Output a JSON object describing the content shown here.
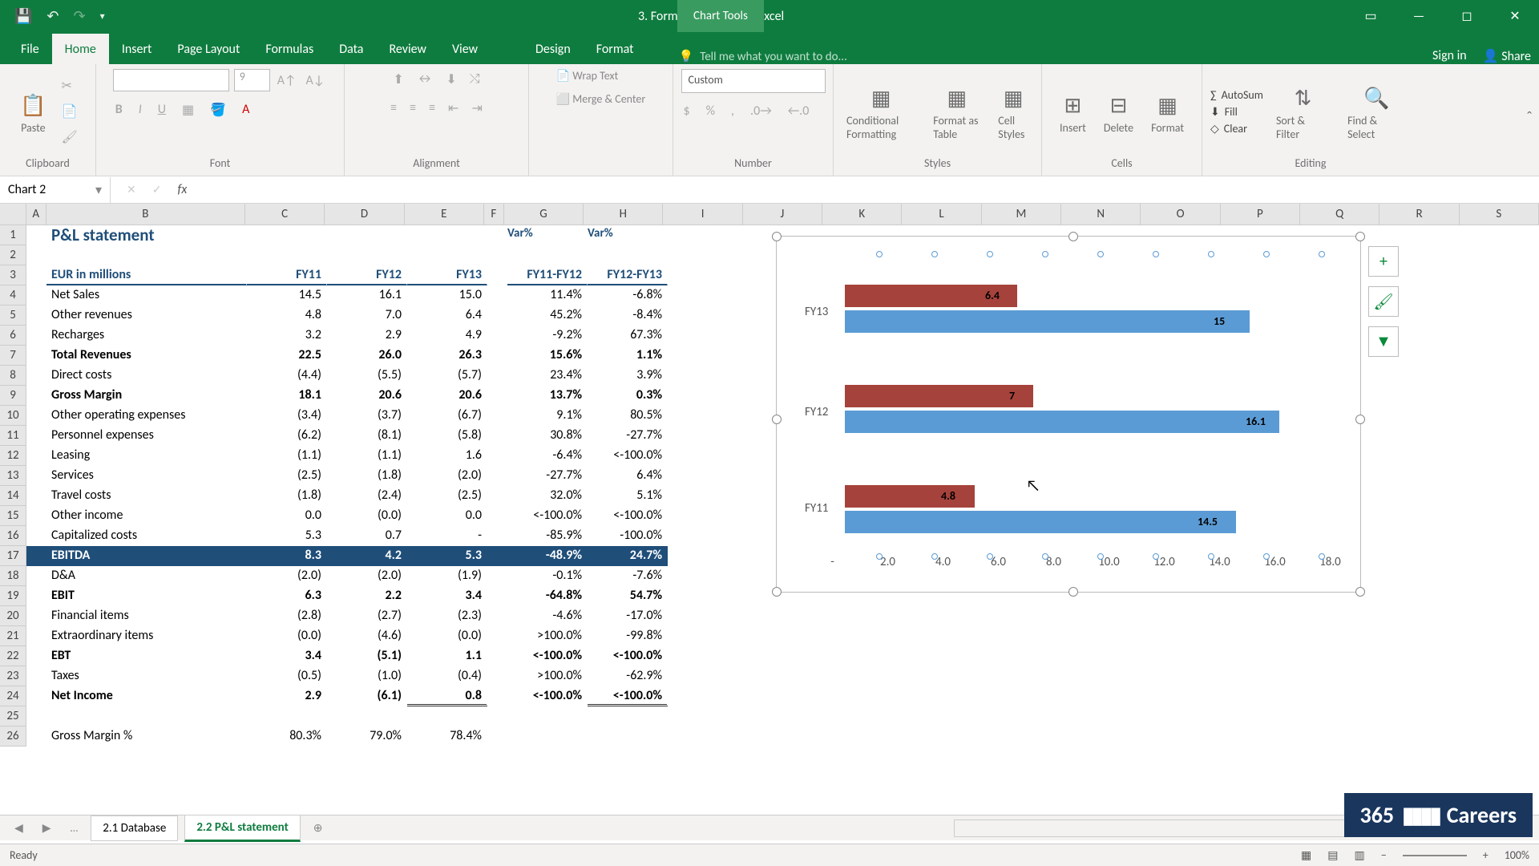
{
  "title": "3. Formatting a Chart - Excel",
  "chartTools": "Chart Tools",
  "tabs": {
    "file": "File",
    "home": "Home",
    "insert": "Insert",
    "pageLayout": "Page Layout",
    "formulas": "Formulas",
    "data": "Data",
    "review": "Review",
    "view": "View",
    "design": "Design",
    "format": "Format"
  },
  "tellme": "Tell me what you want to do...",
  "signin": "Sign in",
  "share": "Share",
  "ribbon": {
    "paste": "Paste",
    "clipboard": "Clipboard",
    "font": "Font",
    "fontsize": "9",
    "alignment": "Alignment",
    "wraptext": "Wrap Text",
    "merge": "Merge & Center",
    "number": "Number",
    "numfmt": "Custom",
    "styles": "Styles",
    "condf": "Conditional Formatting",
    "fmttbl": "Format as Table",
    "cellst": "Cell Styles",
    "cells": "Cells",
    "insert": "Insert",
    "delete": "Delete",
    "format": "Format",
    "editing": "Editing",
    "autosum": "AutoSum",
    "fill": "Fill",
    "clear": "Clear",
    "sortfilter": "Sort & Filter",
    "findsel": "Find & Select"
  },
  "namebox": "Chart 2",
  "sheet": {
    "title": "P&L statement",
    "eurlabel": "EUR in millions",
    "cols": [
      "FY11",
      "FY12",
      "FY13"
    ],
    "varh1": "Var%",
    "varh2": "Var%",
    "varsub1": "FY11-FY12",
    "varsub2": "FY12-FY13",
    "rows": [
      {
        "n": 4,
        "lbl": "Net Sales",
        "v": [
          "14.5",
          "16.1",
          "15.0",
          "11.4%",
          "-6.8%"
        ]
      },
      {
        "n": 5,
        "lbl": "Other revenues",
        "v": [
          "4.8",
          "7.0",
          "6.4",
          "45.2%",
          "-8.4%"
        ]
      },
      {
        "n": 6,
        "lbl": "Recharges",
        "v": [
          "3.2",
          "2.9",
          "4.9",
          "-9.2%",
          "67.3%"
        ]
      },
      {
        "n": 7,
        "lbl": "Total Revenues",
        "b": 1,
        "v": [
          "22.5",
          "26.0",
          "26.3",
          "15.6%",
          "1.1%"
        ]
      },
      {
        "n": 8,
        "lbl": "Direct costs",
        "v": [
          "(4.4)",
          "(5.5)",
          "(5.7)",
          "23.4%",
          "3.9%"
        ]
      },
      {
        "n": 9,
        "lbl": "Gross Margin",
        "b": 1,
        "v": [
          "18.1",
          "20.6",
          "20.6",
          "13.7%",
          "0.3%"
        ]
      },
      {
        "n": 10,
        "lbl": "Other operating expenses",
        "v": [
          "(3.4)",
          "(3.7)",
          "(6.7)",
          "9.1%",
          "80.5%"
        ]
      },
      {
        "n": 11,
        "lbl": "Personnel expenses",
        "v": [
          "(6.2)",
          "(8.1)",
          "(5.8)",
          "30.8%",
          "-27.7%"
        ]
      },
      {
        "n": 12,
        "lbl": "Leasing",
        "v": [
          "(1.1)",
          "(1.1)",
          "1.6",
          "-6.4%",
          "<-100.0%"
        ]
      },
      {
        "n": 13,
        "lbl": "Services",
        "v": [
          "(2.5)",
          "(1.8)",
          "(2.0)",
          "-27.7%",
          "6.4%"
        ]
      },
      {
        "n": 14,
        "lbl": "Travel costs",
        "v": [
          "(1.8)",
          "(2.4)",
          "(2.5)",
          "32.0%",
          "5.1%"
        ]
      },
      {
        "n": 15,
        "lbl": "Other income",
        "v": [
          "0.0",
          "(0.0)",
          "0.0",
          "<-100.0%",
          "<-100.0%"
        ]
      },
      {
        "n": 16,
        "lbl": "Capitalized costs",
        "v": [
          "5.3",
          "0.7",
          "-",
          "-85.9%",
          "-100.0%"
        ]
      },
      {
        "n": 17,
        "lbl": "EBITDA",
        "b": 1,
        "ebitda": 1,
        "v": [
          "8.3",
          "4.2",
          "5.3",
          "-48.9%",
          "24.7%"
        ]
      },
      {
        "n": 18,
        "lbl": "D&A",
        "v": [
          "(2.0)",
          "(2.0)",
          "(1.9)",
          "-0.1%",
          "-7.6%"
        ]
      },
      {
        "n": 19,
        "lbl": "EBIT",
        "b": 1,
        "v": [
          "6.3",
          "2.2",
          "3.4",
          "-64.8%",
          "54.7%"
        ]
      },
      {
        "n": 20,
        "lbl": "Financial items",
        "v": [
          "(2.8)",
          "(2.7)",
          "(2.3)",
          "-4.6%",
          "-17.0%"
        ]
      },
      {
        "n": 21,
        "lbl": "Extraordinary items",
        "v": [
          "(0.0)",
          "(4.6)",
          "(0.0)",
          ">100.0%",
          "-99.8%"
        ]
      },
      {
        "n": 22,
        "lbl": "EBT",
        "b": 1,
        "v": [
          "3.4",
          "(5.1)",
          "1.1",
          "<-100.0%",
          "<-100.0%"
        ]
      },
      {
        "n": 23,
        "lbl": "Taxes",
        "v": [
          "(0.5)",
          "(1.0)",
          "(0.4)",
          ">100.0%",
          "-62.9%"
        ]
      },
      {
        "n": 24,
        "lbl": "Net Income",
        "b": 1,
        "dbl": 1,
        "v": [
          "2.9",
          "(6.1)",
          "0.8",
          "<-100.0%",
          "<-100.0%"
        ]
      }
    ],
    "gm": {
      "lbl": "Gross Margin %",
      "v": [
        "80.3%",
        "79.0%",
        "78.4%"
      ]
    }
  },
  "chart_data": {
    "type": "bar",
    "orientation": "horizontal",
    "categories": [
      "FY13",
      "FY12",
      "FY11"
    ],
    "series": [
      {
        "name": "Net Sales",
        "values": [
          15.0,
          16.1,
          14.5
        ],
        "color": "#5b9bd5"
      },
      {
        "name": "Other revenues",
        "values": [
          6.4,
          7.0,
          4.8
        ],
        "color": "#a5423b"
      }
    ],
    "xlim": [
      0,
      18
    ],
    "xticks": [
      "-",
      "2.0",
      "4.0",
      "6.0",
      "8.0",
      "10.0",
      "12.0",
      "14.0",
      "16.0",
      "18.0"
    ],
    "ylabel": "",
    "xlabel": ""
  },
  "sheetTabs": {
    "db": "2.1 Database",
    "pl": "2.2 P&L statement"
  },
  "status": {
    "ready": "Ready",
    "zoom": "100%"
  },
  "logo": "365 ▮▮▮ Careers"
}
